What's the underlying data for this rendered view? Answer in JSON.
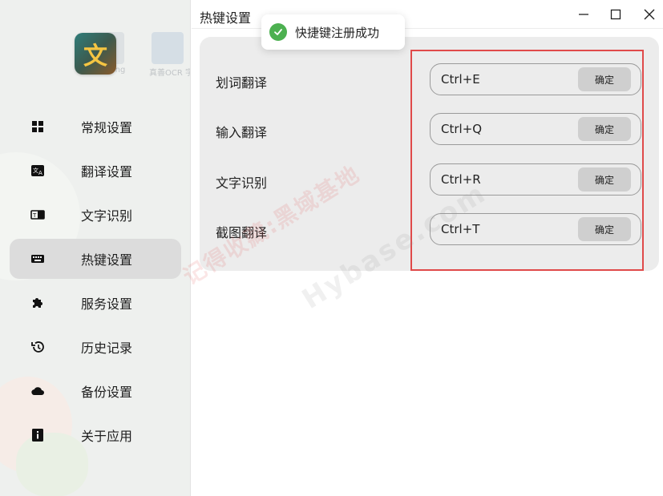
{
  "window": {
    "title": "热键设置"
  },
  "desktop_icons": [
    {
      "label": "jpos.png"
    },
    {
      "label": "真善OCR\n字识别.png"
    }
  ],
  "app": {
    "logo_glyph": "文"
  },
  "sidebar": {
    "items": [
      {
        "label": "常规设置",
        "icon": "grid-icon"
      },
      {
        "label": "翻译设置",
        "icon": "translate-icon"
      },
      {
        "label": "文字识别",
        "icon": "ocr-icon"
      },
      {
        "label": "热键设置",
        "icon": "keyboard-icon",
        "active": true
      },
      {
        "label": "服务设置",
        "icon": "puzzle-icon"
      },
      {
        "label": "历史记录",
        "icon": "history-icon"
      },
      {
        "label": "备份设置",
        "icon": "cloud-icon"
      },
      {
        "label": "关于应用",
        "icon": "info-icon"
      }
    ]
  },
  "toast": {
    "message": "快捷键注册成功",
    "color": "#4cb050"
  },
  "hotkeys": [
    {
      "label": "划词翻译",
      "value": "Ctrl+E",
      "button": "确定"
    },
    {
      "label": "输入翻译",
      "value": "Ctrl+Q",
      "button": "确定"
    },
    {
      "label": "文字识别",
      "value": "Ctrl+R",
      "button": "确定"
    },
    {
      "label": "截图翻译",
      "value": "Ctrl+T",
      "button": "确定"
    }
  ],
  "watermark": {
    "text1": "记得收藏:黑域基地",
    "text2": "Hybase.com"
  },
  "colors": {
    "highlight": "#e04a4a",
    "active_bg": "#dcdcdc"
  }
}
